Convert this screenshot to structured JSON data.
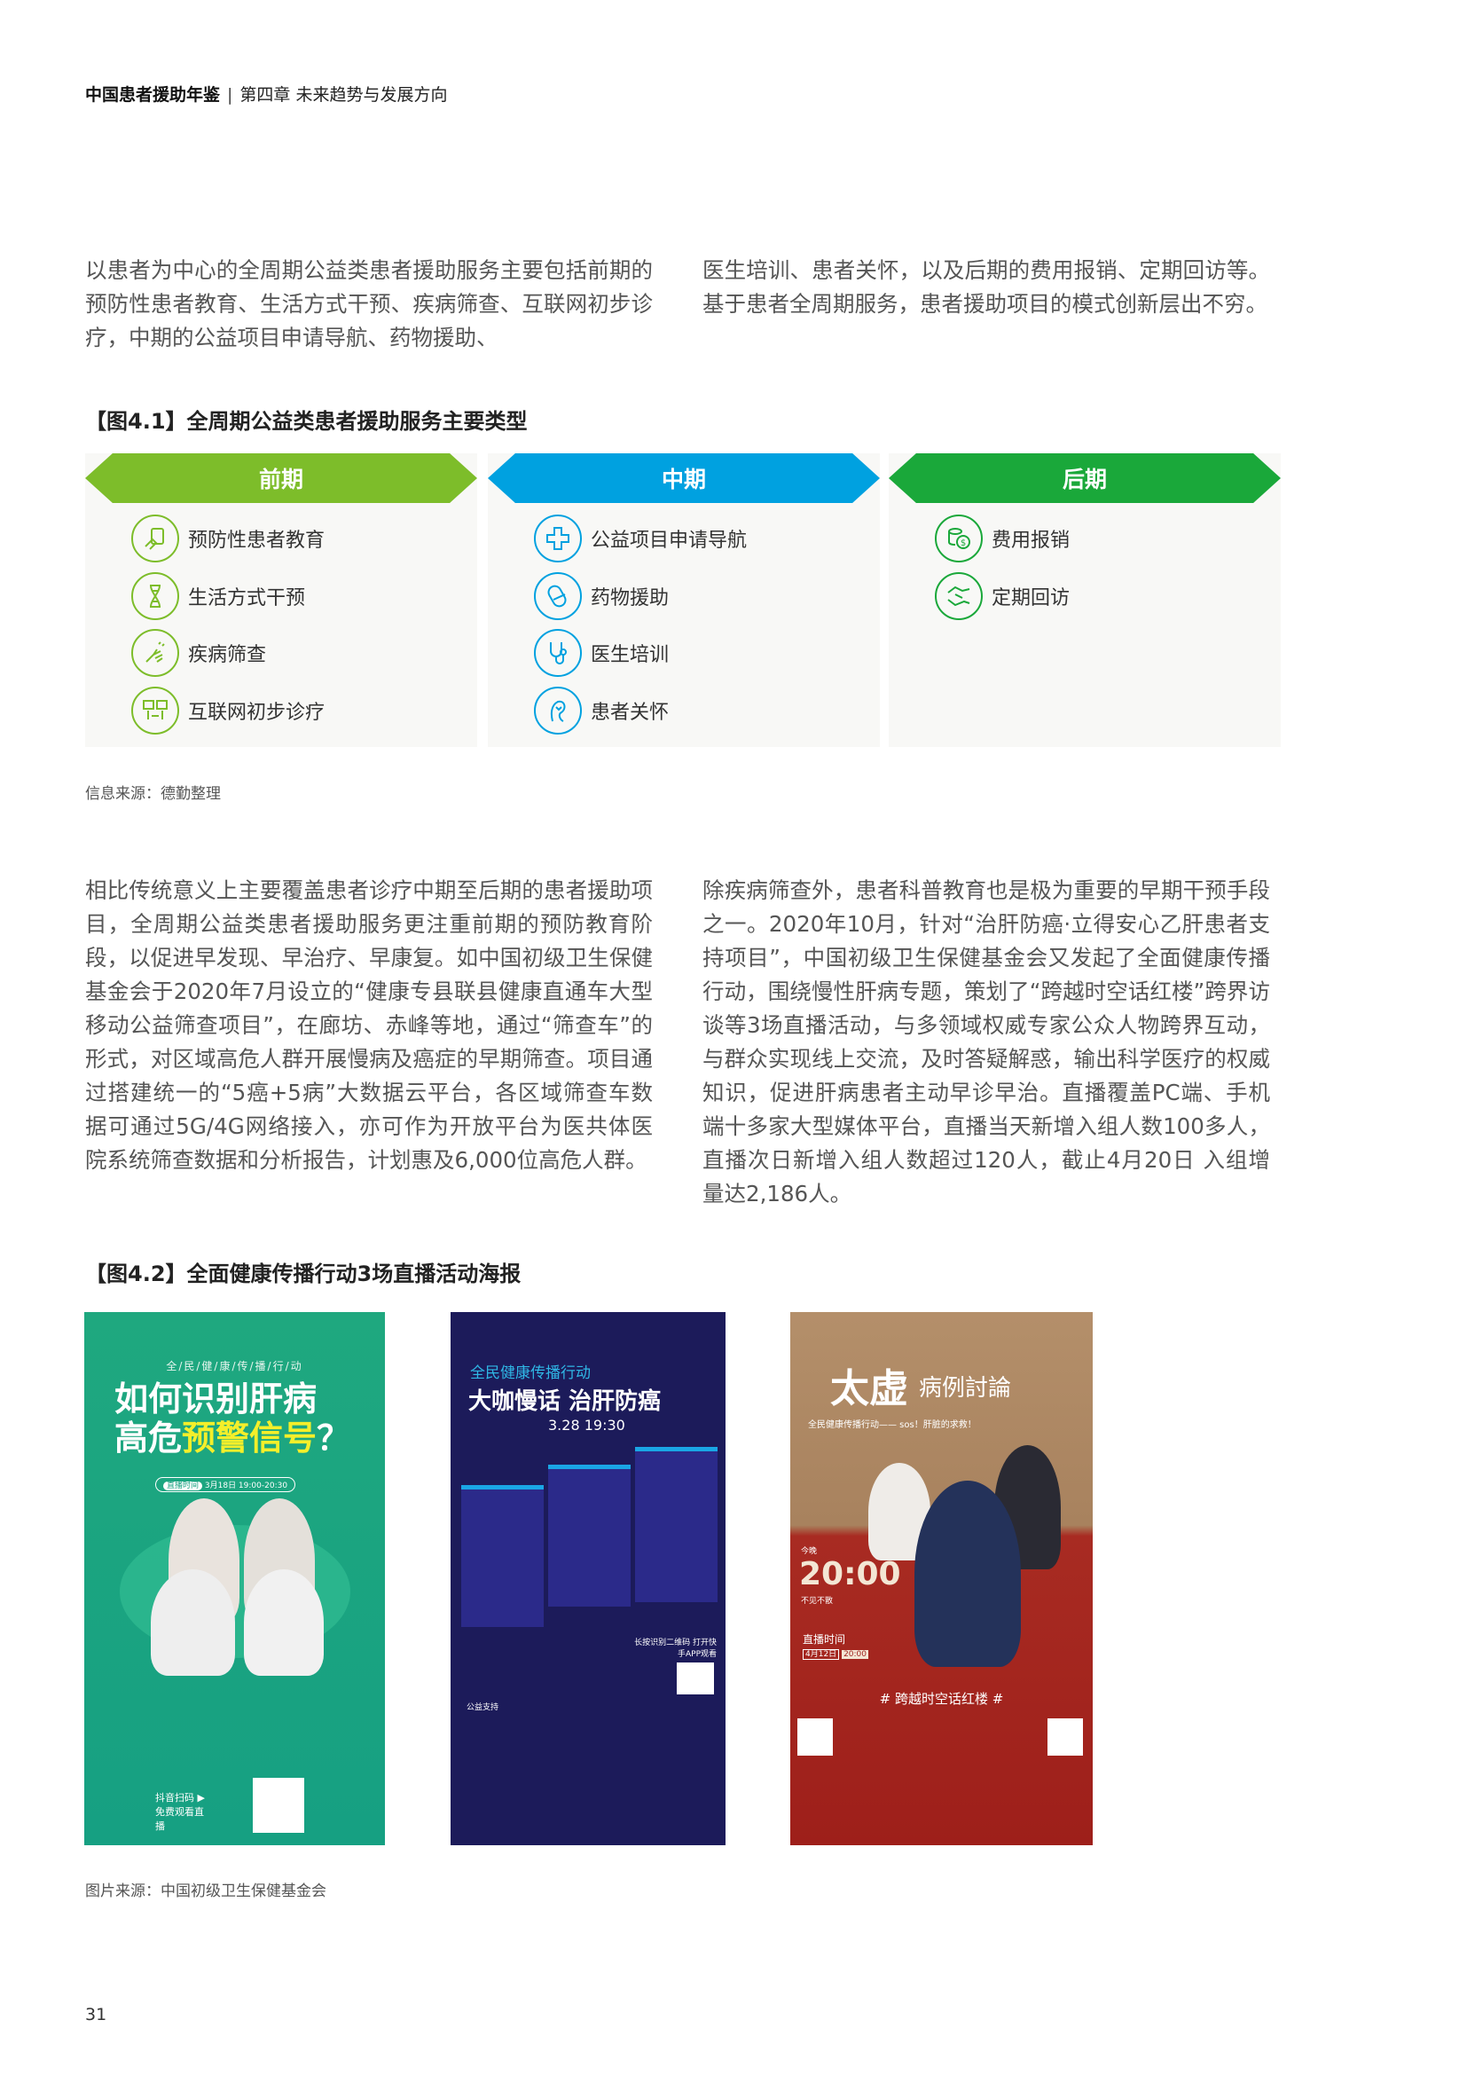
{
  "header": {
    "book": "中国患者援助年鉴",
    "separator": "|",
    "chapter": "第四章 未来趋势与发展方向"
  },
  "intro": {
    "left": "以患者为中心的全周期公益类患者援助服务主要包括前期的预防性患者教育、生活方式干预、疾病筛查、互联网初步诊疗，中期的公益项目申请导航、药物援助、",
    "right": "医生培训、患者关怀，以及后期的费用报销、定期回访等。基于患者全周期服务，患者援助项目的模式创新层出不穷。"
  },
  "figure1": {
    "title": "【图4.1】全周期公益类患者援助服务主要类型",
    "columns": [
      {
        "label": "前期",
        "color": "#7dbd2a",
        "items": [
          {
            "icon": "education-hand-icon",
            "label": "预防性患者教育"
          },
          {
            "icon": "dna-icon",
            "label": "生活方式干预"
          },
          {
            "icon": "screening-hand-icon",
            "label": "疾病筛查"
          },
          {
            "icon": "online-consult-icon",
            "label": "互联网初步诊疗"
          }
        ]
      },
      {
        "label": "中期",
        "color": "#00a1e0",
        "items": [
          {
            "icon": "medical-cross-icon",
            "label": "公益项目申请导航"
          },
          {
            "icon": "pill-icon",
            "label": "药物援助"
          },
          {
            "icon": "stethoscope-icon",
            "label": "医生培训"
          },
          {
            "icon": "patient-care-icon",
            "label": "患者关怀"
          }
        ]
      },
      {
        "label": "后期",
        "color": "#1aa83a",
        "items": [
          {
            "icon": "coins-icon",
            "label": "费用报销"
          },
          {
            "icon": "handshake-icon",
            "label": "定期回访"
          }
        ]
      }
    ],
    "source": "信息来源：德勤整理"
  },
  "body": {
    "left": "相比传统意义上主要覆盖患者诊疗中期至后期的患者援助项目，全周期公益类患者援助服务更注重前期的预防教育阶段，以促进早发现、早治疗、早康复。如中国初级卫生保健基金会于2020年7月设立的“健康专县联县健康直通车大型移动公益筛查项目”，在廊坊、赤峰等地，通过“筛查车”的形式，对区域高危人群开展慢病及癌症的早期筛查。项目通过搭建统一的“5癌+5病”大数据云平台，各区域筛查车数据可通过5G/4G网络接入，亦可作为开放平台为医共体医院系统筛查数据和分析报告，计划惠及6,000位高危人群。",
    "right": "除疾病筛查外，患者科普教育也是极为重要的早期干预手段之一。2020年10月，针对“治肝防癌·立得安心乙肝患者支持项目”，中国初级卫生保健基金会又发起了全面健康传播行动，围绕慢性肝病专题，策划了“跨越时空话红楼”跨界访谈等3场直播活动，与多领域权威专家公众人物跨界互动，与群众实现线上交流，及时答疑解惑，输出科学医疗的权威知识，促进肝病患者主动早诊早治。直播覆盖PC端、手机端十多家大型媒体平台，直播当天新增入组人数100多人，直播次日新增入组人数超过120人，截止4月20日 入组增量达2,186人。"
  },
  "figure2": {
    "title": "【图4.2】全面健康传播行动3场直播活动海报",
    "posters": [
      {
        "subtitle": "全/民/健/康/传/播/行/动",
        "title_line1": "如何识别肝病",
        "title_line2_a": "高危",
        "title_line2_b": "预警信号",
        "title_line2_c": "？",
        "time_label": "直播时间",
        "time": "3月18日 19:00-20:30",
        "cta": "抖音扫码 ▶ 免费观看直播"
      },
      {
        "subtitle": "全民健康传播行动",
        "title": "大咖慢话 治肝防癌",
        "time": "3.28 19:30",
        "cta": "长按识别二维码 打开快手APP观看",
        "support": "公益支持"
      },
      {
        "title_a": "太虚",
        "title_b": "病例討論",
        "subtitle": "全民健康传播行动—— sos！肝脏的求救！",
        "tonight": "今晚",
        "time": "20:00",
        "tagline": "不见不散",
        "date_label": "直播时间",
        "date": "4月12日",
        "date_time": "20:00",
        "hashtag": "# 跨越时空话红楼 #"
      }
    ],
    "source": "图片来源：中国初级卫生保健基金会"
  },
  "page_number": "31"
}
